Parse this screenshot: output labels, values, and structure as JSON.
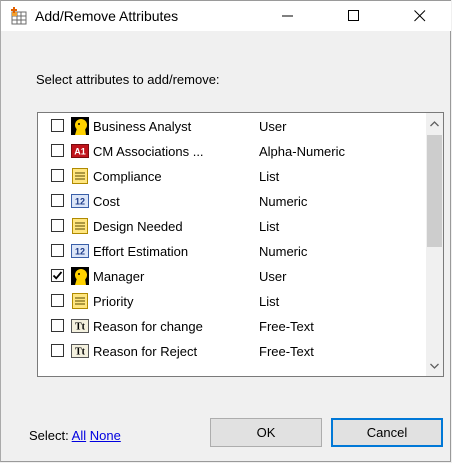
{
  "window": {
    "title": "Add/Remove Attributes"
  },
  "prompt": "Select attributes to add/remove:",
  "attributes": [
    {
      "name": "Business Analyst",
      "type": "User",
      "checked": false,
      "icon": "user-icon"
    },
    {
      "name": "CM Associations ...",
      "type": "Alpha-Numeric",
      "checked": false,
      "icon": "alpha-numeric-icon"
    },
    {
      "name": "Compliance",
      "type": "List",
      "checked": false,
      "icon": "list-icon"
    },
    {
      "name": "Cost",
      "type": "Numeric",
      "checked": false,
      "icon": "numeric-icon"
    },
    {
      "name": "Design Needed",
      "type": "List",
      "checked": false,
      "icon": "list-icon"
    },
    {
      "name": "Effort Estimation",
      "type": "Numeric",
      "checked": false,
      "icon": "numeric-icon"
    },
    {
      "name": "Manager",
      "type": "User",
      "checked": true,
      "icon": "user-icon"
    },
    {
      "name": "Priority",
      "type": "List",
      "checked": false,
      "icon": "list-icon"
    },
    {
      "name": "Reason for change",
      "type": "Free-Text",
      "checked": false,
      "icon": "free-text-icon"
    },
    {
      "name": "Reason for Reject",
      "type": "Free-Text",
      "checked": false,
      "icon": "free-text-icon"
    }
  ],
  "footer": {
    "select_label": "Select:",
    "all_label": "All",
    "none_label": "None",
    "ok_label": "OK",
    "cancel_label": "Cancel"
  },
  "icon_glyphs": {
    "alpha_numeric": "A1",
    "numeric": "12",
    "free_text": "Tt"
  }
}
